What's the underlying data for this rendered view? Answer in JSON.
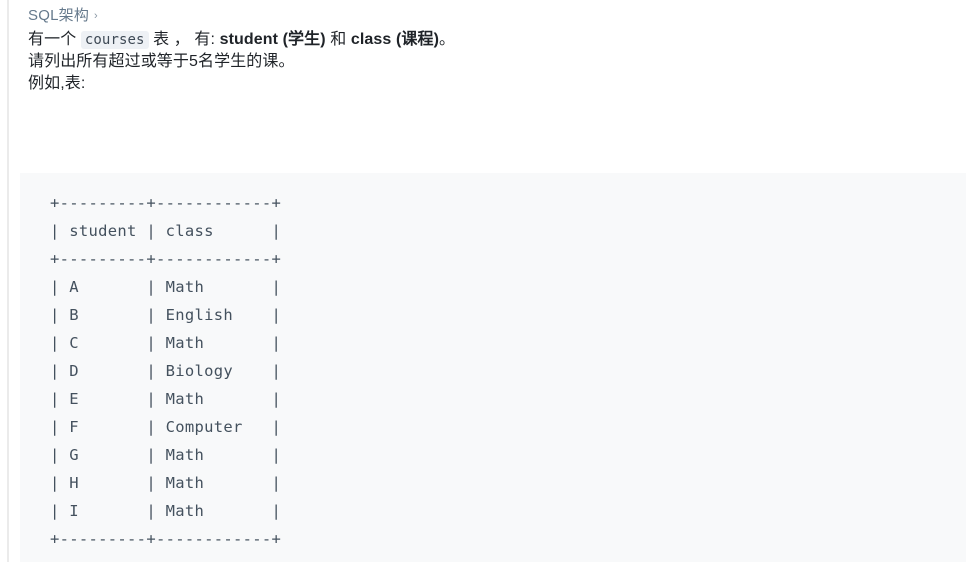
{
  "breadcrumb": {
    "label": "SQL架构",
    "separator": "›",
    "separator_icon": "chevron-right-icon"
  },
  "paragraphs": {
    "p1": {
      "before_code": "有一个 ",
      "code": "courses",
      "after_code": " 表 ， 有: ",
      "bold1": "student (学生)",
      "middle": " 和 ",
      "bold2": "class (课程)",
      "tail": "。"
    },
    "p2": "请列出所有超过或等于5名学生的课。",
    "p3": "例如,表:"
  },
  "codeblock": {
    "language": "text",
    "content": "+---------+------------+\n| student | class      |\n+---------+------------+\n| A       | Math       |\n| B       | English    |\n| C       | Math       |\n| D       | Biology    |\n| E       | Math       |\n| F       | Computer   |\n| G       | Math       |\n| H       | Math       |\n| I       | Math       |\n+---------+------------+",
    "table": {
      "columns": [
        "student",
        "class"
      ],
      "rows": [
        [
          "A",
          "Math"
        ],
        [
          "B",
          "English"
        ],
        [
          "C",
          "Math"
        ],
        [
          "D",
          "Biology"
        ],
        [
          "E",
          "Math"
        ],
        [
          "F",
          "Computer"
        ],
        [
          "G",
          "Math"
        ],
        [
          "H",
          "Math"
        ],
        [
          "I",
          "Math"
        ]
      ]
    }
  },
  "colors": {
    "text": "#1f2328",
    "breadcrumb": "#65798c",
    "code_bg": "#f8f9fa",
    "code_text": "#44515e",
    "inline_code_bg": "#eef1f5"
  }
}
